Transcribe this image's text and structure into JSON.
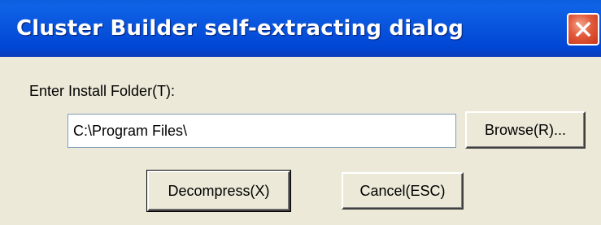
{
  "window": {
    "title": "Cluster Builder self-extracting dialog",
    "close_icon": "close-icon"
  },
  "form": {
    "label": "Enter Install Folder(T):",
    "install_folder_value": "C:\\Program Files\\",
    "browse_label": "Browse(R)..."
  },
  "actions": {
    "decompress_label": "Decompress(X)",
    "cancel_label": "Cancel(ESC)"
  },
  "colors": {
    "titlebar_blue": "#0853dc",
    "dialog_face": "#ece9d8",
    "close_red": "#e2593a"
  }
}
